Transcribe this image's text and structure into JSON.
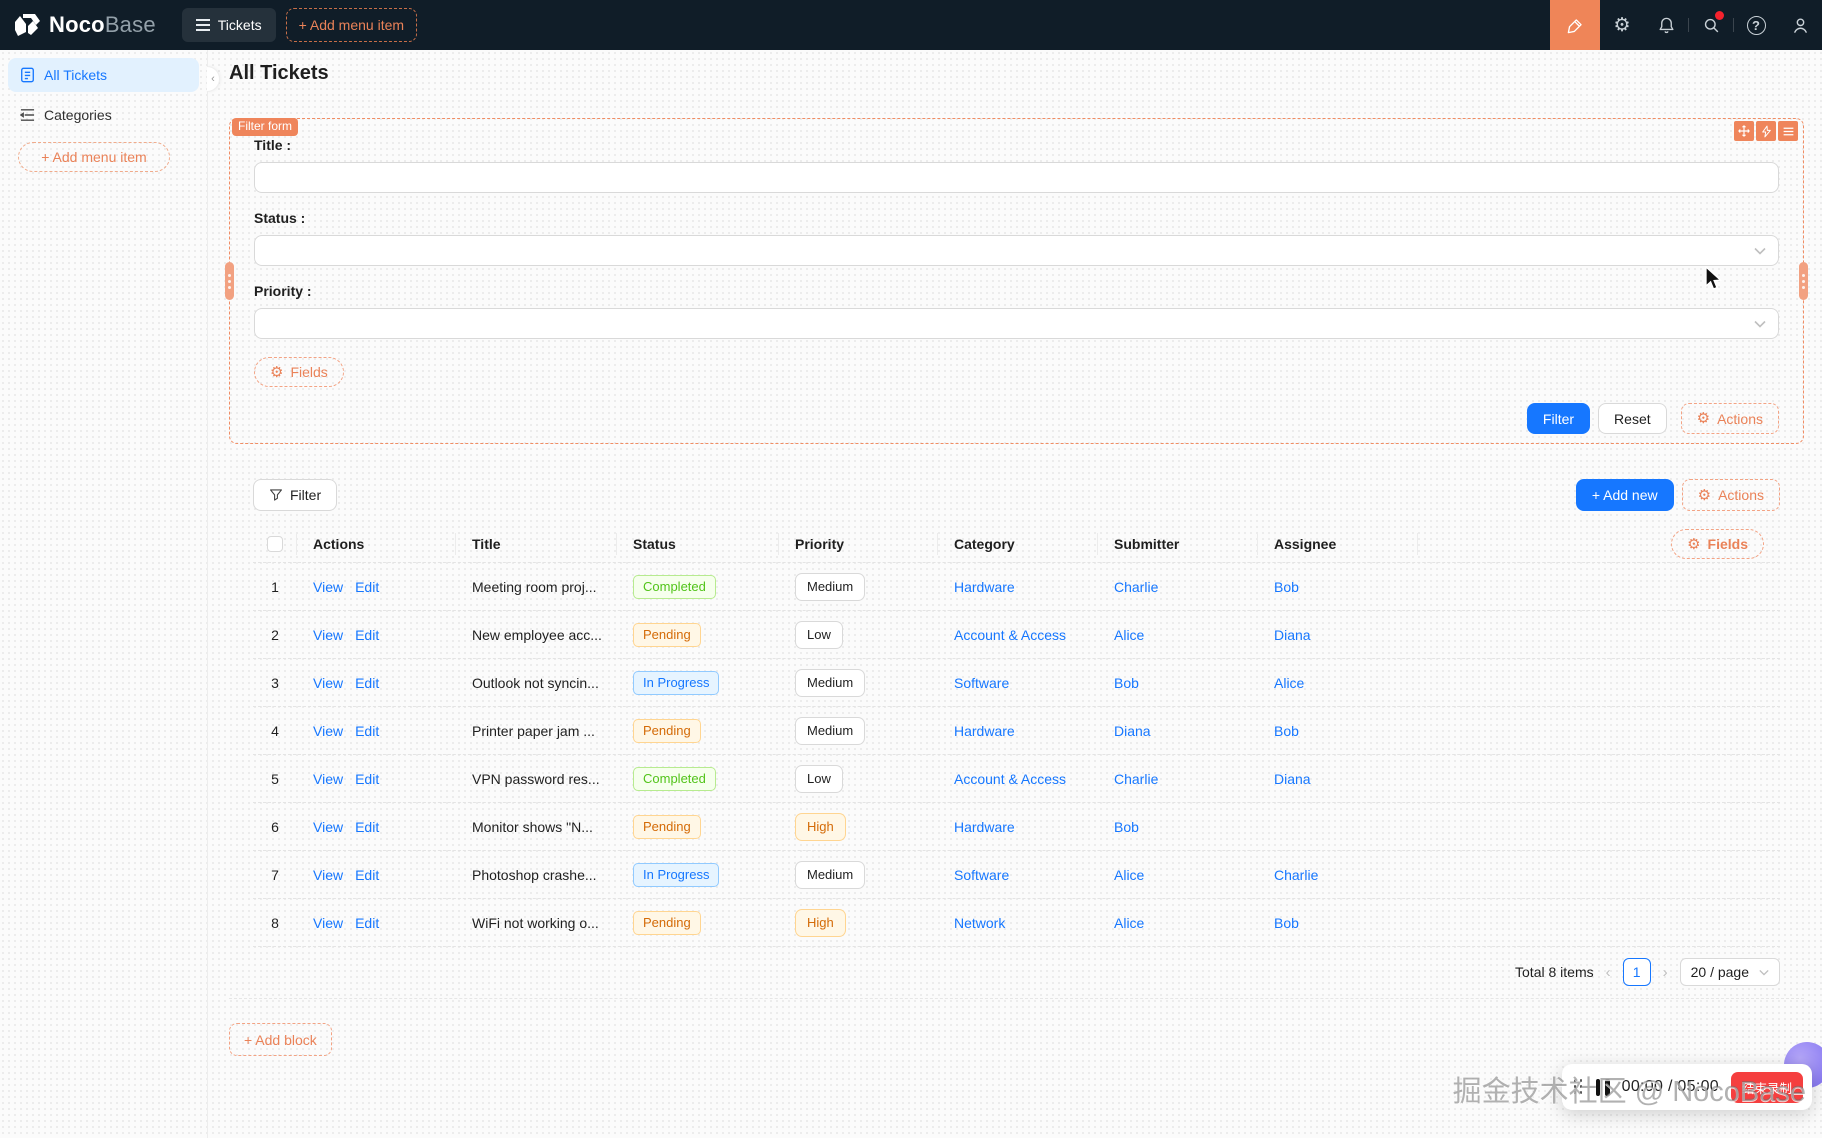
{
  "topbar": {
    "logo_noco": "Noco",
    "logo_base": "Base",
    "menu_label": "Tickets",
    "add_menu_item": "+ Add menu item"
  },
  "sidebar": {
    "items": [
      {
        "label": "All Tickets"
      },
      {
        "label": "Categories"
      }
    ],
    "add_menu_item": "+ Add menu item"
  },
  "page": {
    "title": "All Tickets"
  },
  "filter_form": {
    "tag": "Filter form",
    "fields": [
      {
        "label": "Title :"
      },
      {
        "label": "Status :"
      },
      {
        "label": "Priority :"
      }
    ],
    "fields_button": "Fields",
    "filter_button": "Filter",
    "reset_button": "Reset",
    "actions_button": "Actions"
  },
  "table_block": {
    "filter_button": "Filter",
    "add_new_button": "+ Add new",
    "actions_button": "Actions",
    "fields_button": "Fields",
    "columns": [
      "Actions",
      "Title",
      "Status",
      "Priority",
      "Category",
      "Submitter",
      "Assignee"
    ],
    "action_links": [
      "View",
      "Edit"
    ],
    "rows": [
      {
        "index": "1",
        "title": "Meeting room proj...",
        "status": "Completed",
        "status_color": "green",
        "priority": "Medium",
        "priority_color": "default",
        "category": "Hardware",
        "submitter": "Charlie",
        "assignee": "Bob"
      },
      {
        "index": "2",
        "title": "New employee acc...",
        "status": "Pending",
        "status_color": "orange",
        "priority": "Low",
        "priority_color": "default",
        "category": "Account & Access",
        "submitter": "Alice",
        "assignee": "Diana"
      },
      {
        "index": "3",
        "title": "Outlook not syncin...",
        "status": "In Progress",
        "status_color": "blue",
        "priority": "Medium",
        "priority_color": "default",
        "category": "Software",
        "submitter": "Bob",
        "assignee": "Alice"
      },
      {
        "index": "4",
        "title": "Printer paper jam ...",
        "status": "Pending",
        "status_color": "orange",
        "priority": "Medium",
        "priority_color": "default",
        "category": "Hardware",
        "submitter": "Diana",
        "assignee": "Bob"
      },
      {
        "index": "5",
        "title": "VPN password res...",
        "status": "Completed",
        "status_color": "green",
        "priority": "Low",
        "priority_color": "default",
        "category": "Account & Access",
        "submitter": "Charlie",
        "assignee": "Diana"
      },
      {
        "index": "6",
        "title": "Monitor shows \"N...",
        "status": "Pending",
        "status_color": "orange",
        "priority": "High",
        "priority_color": "warm",
        "category": "Hardware",
        "submitter": "Bob",
        "assignee": ""
      },
      {
        "index": "7",
        "title": "Photoshop crashe...",
        "status": "In Progress",
        "status_color": "blue",
        "priority": "Medium",
        "priority_color": "default",
        "category": "Software",
        "submitter": "Alice",
        "assignee": "Charlie"
      },
      {
        "index": "8",
        "title": "WiFi not working o...",
        "status": "Pending",
        "status_color": "orange",
        "priority": "High",
        "priority_color": "warm",
        "category": "Network",
        "submitter": "Alice",
        "assignee": "Bob"
      }
    ],
    "pagination": {
      "total": "Total 8 items",
      "page": "1",
      "page_size": "20 / page"
    }
  },
  "add_block_button": "+ Add block",
  "recorder": {
    "time": "00:00 / 05:00",
    "stop_button": "结束录制"
  },
  "watermark": "掘金技术社区 @ NocoBase",
  "colors": {
    "accent_orange": "#EF855B",
    "primary_blue": "#1677FF",
    "topbar_bg": "#101D28",
    "tag_green_text": "#52C41A",
    "tag_orange_text": "#D46B08",
    "tag_blue_text": "#1677FF",
    "stop_red": "#F53F3F"
  }
}
